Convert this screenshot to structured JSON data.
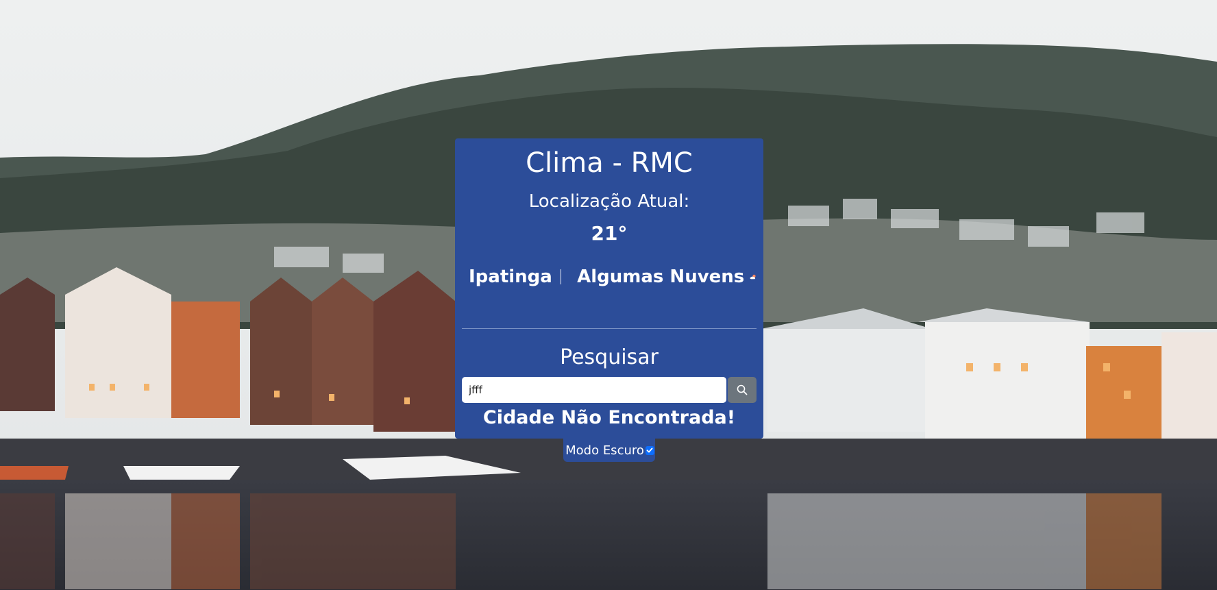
{
  "app": {
    "title": "Clima - RMC"
  },
  "current": {
    "location_label": "Localização Atual:",
    "temperature": "21°",
    "city": "Ipatinga",
    "description": "Algumas Nuvens",
    "icon": "partly-cloudy-icon"
  },
  "search": {
    "heading": "Pesquisar",
    "input_value": "jfff",
    "button_icon": "search-icon",
    "error_message": "Cidade Não Encontrada!"
  },
  "settings": {
    "dark_mode_label": "Modo Escuro",
    "dark_mode_checked": true
  },
  "colors": {
    "card_background": "#2c4d99",
    "search_button": "#6c757d",
    "checkbox_accent": "#0d6efd",
    "text": "#ffffff"
  }
}
